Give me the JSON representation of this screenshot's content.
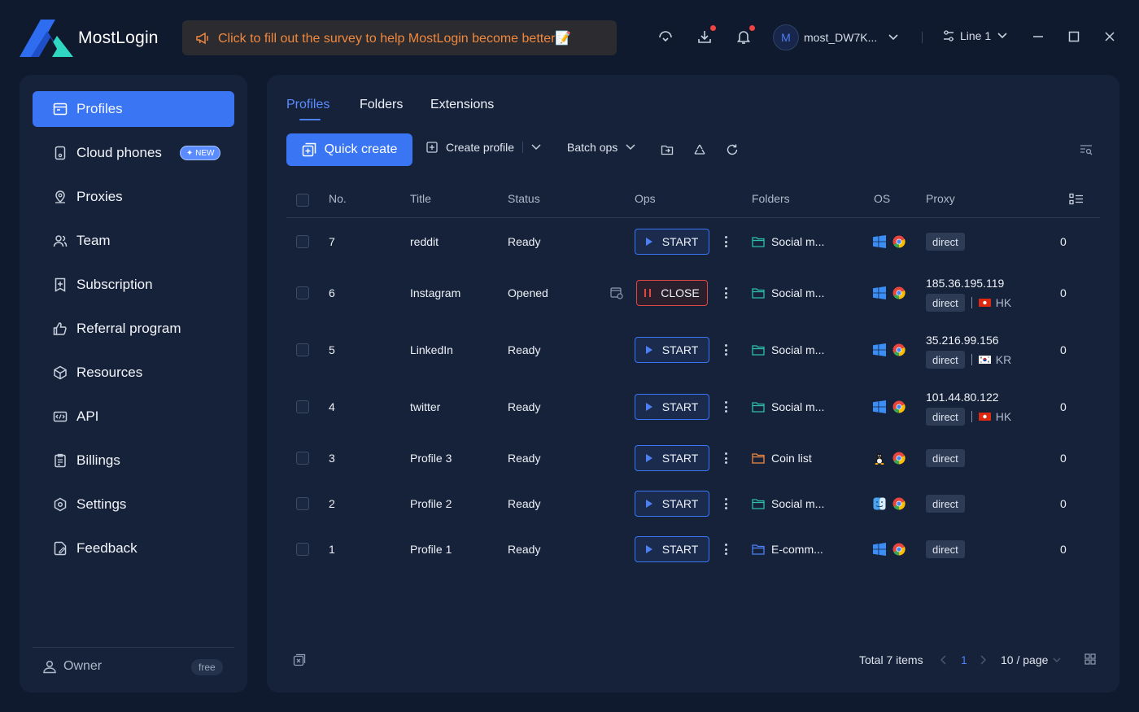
{
  "app": {
    "name": "MostLogin"
  },
  "survey": {
    "text": "Click to fill out the survey to help MostLogin become better📝"
  },
  "header": {
    "user_initial": "M",
    "user_name": "most_DW7K...",
    "line_label": "Line 1",
    "icons": [
      "support-icon",
      "download-icon",
      "bell-icon",
      "minimize-icon",
      "maximize-icon",
      "close-icon"
    ]
  },
  "sidebar": {
    "items": [
      {
        "label": "Profiles",
        "icon": "profiles-icon",
        "active": true
      },
      {
        "label": "Cloud phones",
        "icon": "phone-icon",
        "badge": "NEW"
      },
      {
        "label": "Proxies",
        "icon": "location-icon"
      },
      {
        "label": "Team",
        "icon": "team-icon"
      },
      {
        "label": "Subscription",
        "icon": "subscription-icon"
      },
      {
        "label": "Referral program",
        "icon": "thumbs-up-icon"
      },
      {
        "label": "Resources",
        "icon": "cube-icon"
      },
      {
        "label": "API",
        "icon": "api-icon"
      },
      {
        "label": "Billings",
        "icon": "clipboard-icon"
      },
      {
        "label": "Settings",
        "icon": "settings-icon"
      },
      {
        "label": "Feedback",
        "icon": "feedback-icon"
      }
    ],
    "owner_label": "Owner",
    "plan": "free"
  },
  "tabs": [
    "Profiles",
    "Folders",
    "Extensions"
  ],
  "toolbar": {
    "quick_create": "Quick create",
    "create_profile": "Create profile",
    "batch_ops": "Batch ops"
  },
  "table": {
    "columns": [
      "No.",
      "Title",
      "Status",
      "Ops",
      "Folders",
      "OS",
      "Proxy"
    ],
    "rows": [
      {
        "no": "7",
        "title": "reddit",
        "status": "Ready",
        "op": "START",
        "folder": "Social m...",
        "os": "windows",
        "proxy_ip": "",
        "proxy_type": "direct",
        "country": "",
        "count": "0"
      },
      {
        "no": "6",
        "title": "Instagram",
        "status": "Opened",
        "op": "CLOSE",
        "folder": "Social m...",
        "os": "windows",
        "proxy_ip": "185.36.195.119",
        "proxy_type": "direct",
        "country": "HK",
        "count": "0"
      },
      {
        "no": "5",
        "title": "LinkedIn",
        "status": "Ready",
        "op": "START",
        "folder": "Social m...",
        "os": "windows",
        "proxy_ip": "35.216.99.156",
        "proxy_type": "direct",
        "country": "KR",
        "count": "0"
      },
      {
        "no": "4",
        "title": "twitter",
        "status": "Ready",
        "op": "START",
        "folder": "Social m...",
        "os": "windows",
        "proxy_ip": "101.44.80.122",
        "proxy_type": "direct",
        "country": "HK",
        "count": "0"
      },
      {
        "no": "3",
        "title": "Profile 3",
        "status": "Ready",
        "op": "START",
        "folder": "Coin list",
        "os": "linux",
        "proxy_ip": "",
        "proxy_type": "direct",
        "country": "",
        "count": "0"
      },
      {
        "no": "2",
        "title": "Profile 2",
        "status": "Ready",
        "op": "START",
        "folder": "Social m...",
        "os": "macos",
        "proxy_ip": "",
        "proxy_type": "direct",
        "country": "",
        "count": "0"
      },
      {
        "no": "1",
        "title": "Profile 1",
        "status": "Ready",
        "op": "START",
        "folder": "E-comm...",
        "os": "windows",
        "proxy_ip": "",
        "proxy_type": "direct",
        "country": "",
        "count": "0"
      }
    ]
  },
  "footer": {
    "total": "Total 7 items",
    "page": "1",
    "per_page": "10 / page"
  },
  "colors": {
    "accent": "#3a75f3",
    "danger": "#e04848",
    "warning": "#f0883e",
    "teal_folder": "#2dbfa8",
    "orange_folder": "#f0883e",
    "blue_folder": "#4d7ff5"
  }
}
